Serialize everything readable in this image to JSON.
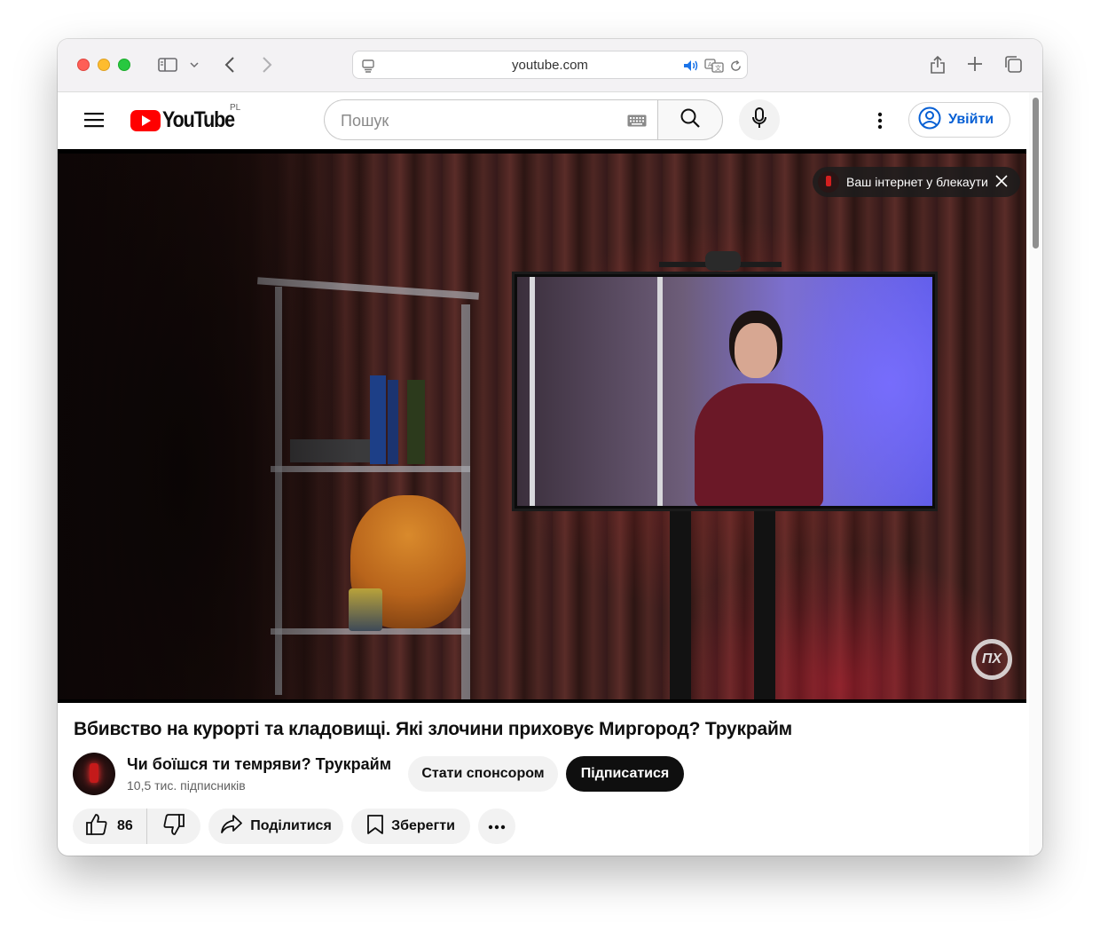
{
  "browser": {
    "url": "youtube.com"
  },
  "header": {
    "logo_text": "YouTube",
    "region": "PL",
    "search_placeholder": "Пошук",
    "signin_label": "Увійти"
  },
  "video": {
    "info_chip": "Ваш інтернет у блекаути",
    "watermark": "ПХ",
    "title": "Вбивство на курорті та кладовищі. Які злочини приховує Миргород? Трукрайм"
  },
  "channel": {
    "name": "Чи боїшся ти темряви? Трукрайм",
    "subscribers": "10,5 тис. підписників",
    "sponsor_label": "Стати спонсором",
    "subscribe_label": "Підписатися"
  },
  "actions": {
    "likes": "86",
    "share_label": "Поділитися",
    "save_label": "Зберегти"
  },
  "colors": {
    "brand_red": "#ff0000",
    "link_blue": "#065fd4",
    "text": "#0f0f0f"
  }
}
